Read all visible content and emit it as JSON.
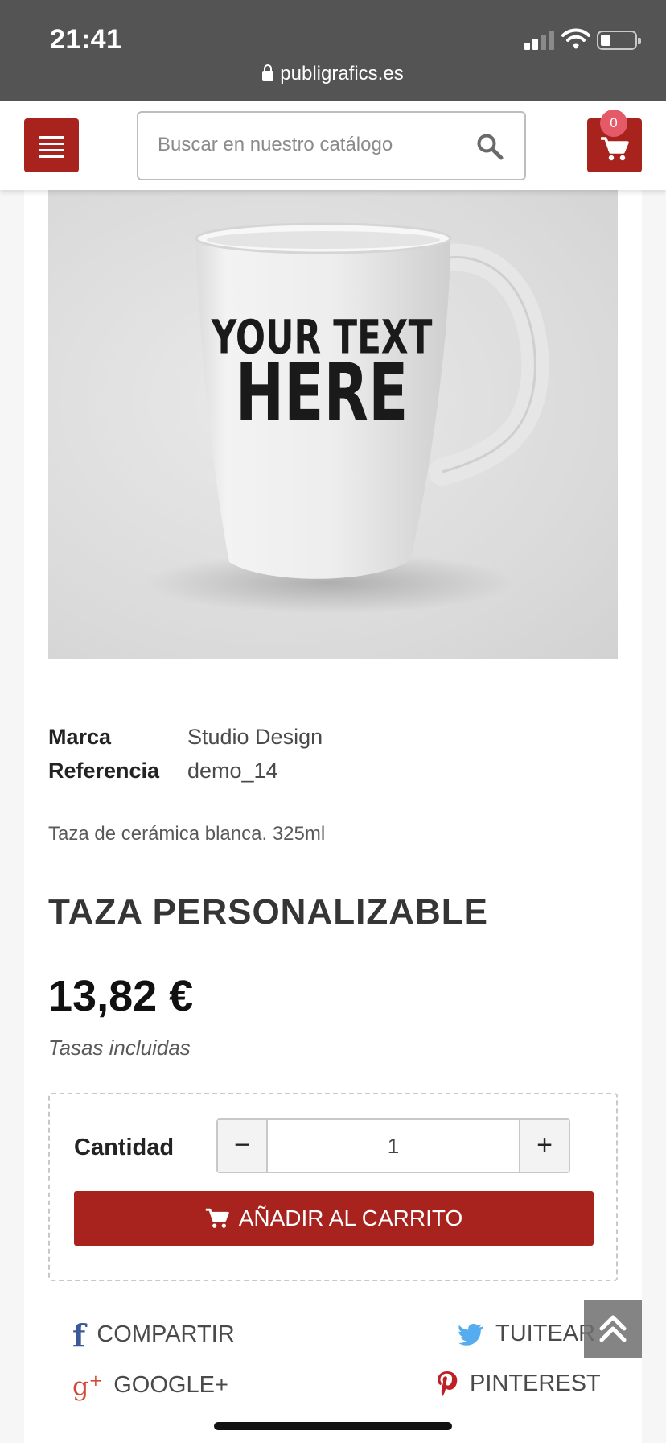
{
  "status_bar": {
    "time": "21:41",
    "url": "publigrafics.es"
  },
  "header": {
    "search_placeholder": "Buscar en nuestro catálogo",
    "cart_count": "0"
  },
  "product": {
    "image_text_line1": "YOUR TEXT",
    "image_text_line2": "HERE",
    "features": [
      {
        "label": "Marca",
        "value": "Studio Design"
      },
      {
        "label": "Referencia",
        "value": "demo_14"
      }
    ],
    "description": "Taza de cerámica blanca. 325ml",
    "title": "TAZA PERSONALIZABLE",
    "price": "13,82 €",
    "tax_note": "Tasas incluidas"
  },
  "add_to_cart": {
    "quantity_label": "Cantidad",
    "quantity": "1",
    "minus": "−",
    "plus": "+",
    "button_label": "AÑADIR AL CARRITO"
  },
  "social": {
    "facebook": "COMPARTIR",
    "twitter": "TUITEAR",
    "googleplus": "GOOGLE+",
    "pinterest": "PINTEREST"
  },
  "colors": {
    "brand_red": "#a8231e",
    "badge_pink": "#e45a68",
    "status_bar": "#545454"
  }
}
